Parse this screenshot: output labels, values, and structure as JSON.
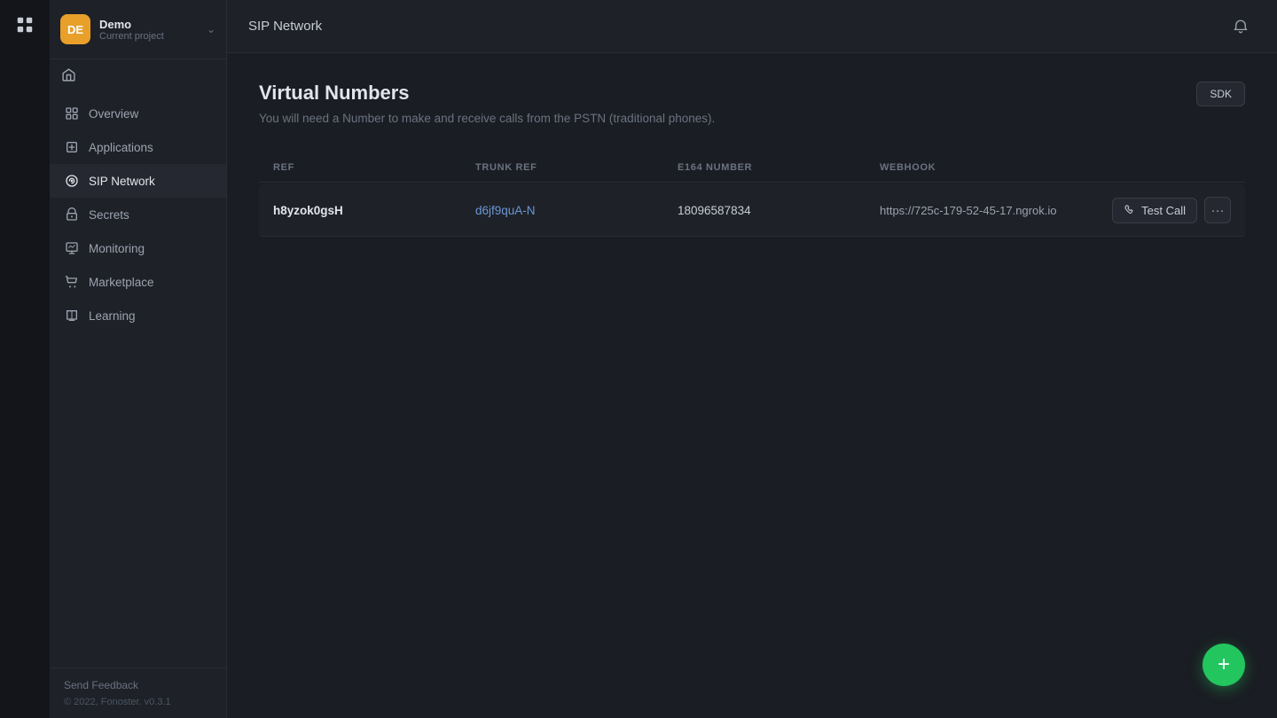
{
  "rail": {
    "logo_icon": "grid-icon"
  },
  "sidebar": {
    "project_avatar": "DE",
    "project_name": "Demo",
    "project_subtitle": "Current project",
    "nav_items": [
      {
        "id": "overview",
        "label": "Overview",
        "icon": "overview-icon",
        "active": false
      },
      {
        "id": "applications",
        "label": "Applications",
        "icon": "applications-icon",
        "active": false
      },
      {
        "id": "sip-network",
        "label": "SIP Network",
        "icon": "sip-icon",
        "active": true
      },
      {
        "id": "secrets",
        "label": "Secrets",
        "icon": "secrets-icon",
        "active": false
      },
      {
        "id": "monitoring",
        "label": "Monitoring",
        "icon": "monitoring-icon",
        "active": false
      },
      {
        "id": "marketplace",
        "label": "Marketplace",
        "icon": "marketplace-icon",
        "active": false
      },
      {
        "id": "learning",
        "label": "Learning",
        "icon": "learning-icon",
        "active": false
      }
    ],
    "send_feedback": "Send Feedback",
    "version": "© 2022, Fonoster. v0.3.1"
  },
  "topbar": {
    "title": "SIP Network",
    "bell_icon": "bell-icon"
  },
  "content": {
    "page_title": "Virtual Numbers",
    "page_description": "You will need a Number to make and receive calls from the PSTN (traditional phones).",
    "sdk_label": "SDK",
    "table": {
      "columns": [
        {
          "id": "ref",
          "label": "REF"
        },
        {
          "id": "trunk_ref",
          "label": "TRUNK REF"
        },
        {
          "id": "e164",
          "label": "E164 NUMBER"
        },
        {
          "id": "webhook",
          "label": "WEBHOOK"
        }
      ],
      "rows": [
        {
          "ref": "h8yzok0gsH",
          "trunk_ref": "d6jf9quA-N",
          "e164": "18096587834",
          "webhook": "https://725c-179-52-45-17.ngrok.io"
        }
      ]
    },
    "test_call_label": "Test Call",
    "more_label": "...",
    "fab_label": "+"
  }
}
